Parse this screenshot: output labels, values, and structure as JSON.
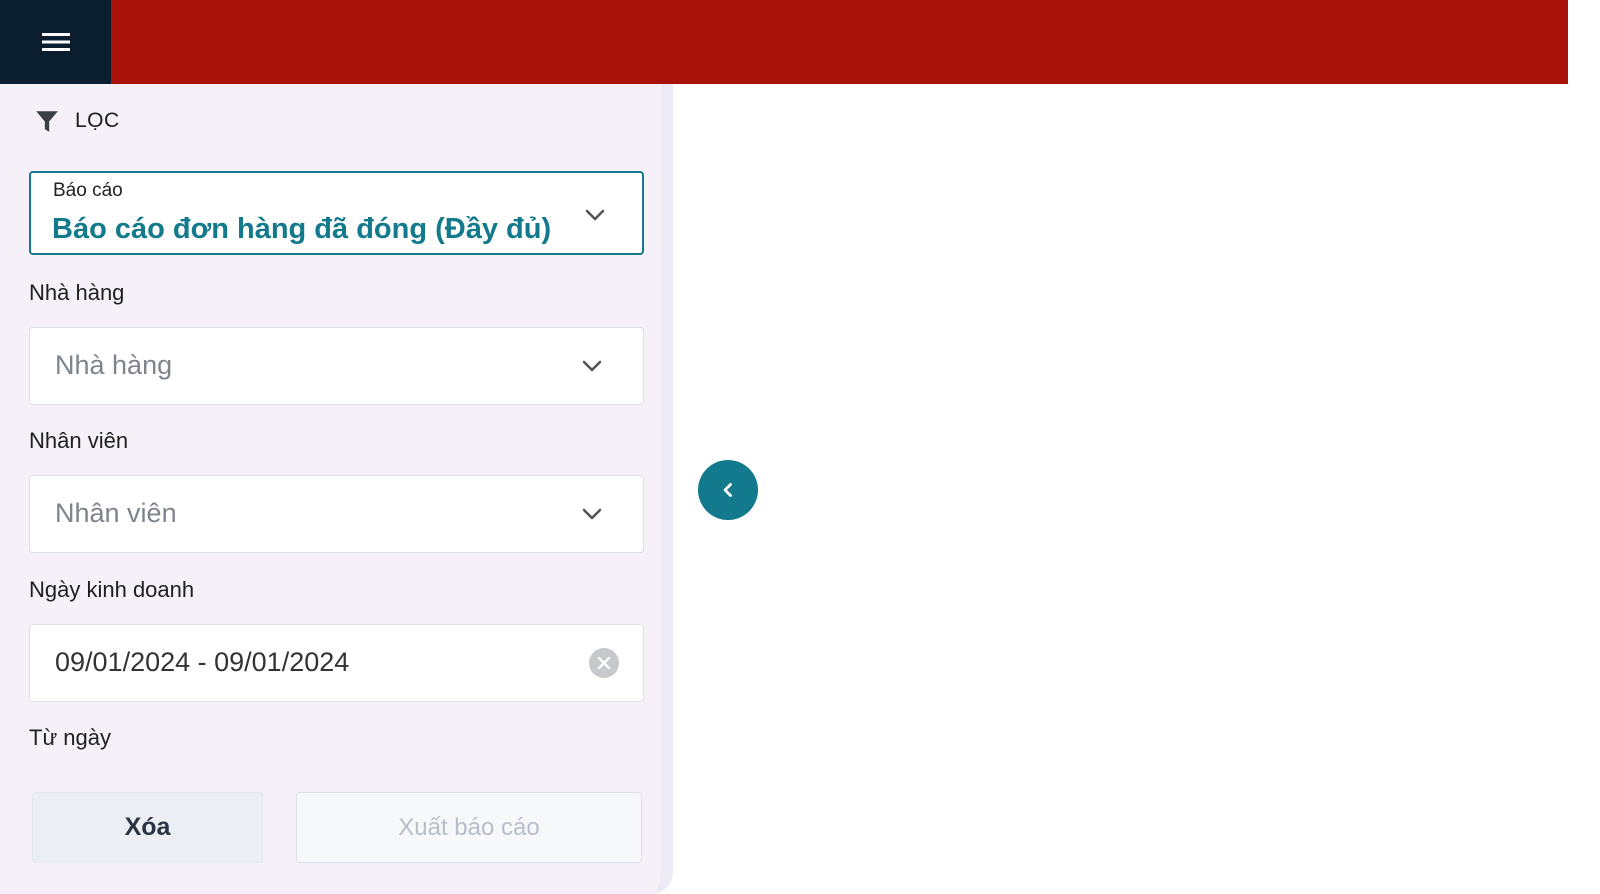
{
  "filter": {
    "title": "LỌC",
    "report": {
      "label": "Báo cáo",
      "value": "Báo cáo đơn hàng đã đóng (Đầy đủ)"
    },
    "restaurant": {
      "label": "Nhà hàng",
      "placeholder": "Nhà hàng"
    },
    "staff": {
      "label": "Nhân viên",
      "placeholder": "Nhân viên"
    },
    "business_date": {
      "label": "Ngày kinh doanh",
      "value": "09/01/2024 - 09/01/2024"
    },
    "from_date": {
      "label": "Từ ngày"
    },
    "buttons": {
      "clear": "Xóa",
      "export": "Xuất báo cáo"
    }
  },
  "colors": {
    "topbar": "#a8120a",
    "menu_bg": "#0a1e30",
    "accent": "#137a8d",
    "sidebar_bg": "#f6f0f8"
  },
  "icons": {
    "menu": "hamburger-icon",
    "filter": "funnel-icon",
    "dropdown": "chevron-down-icon",
    "clear": "close-circle-icon",
    "collapse": "chevron-left-icon"
  }
}
